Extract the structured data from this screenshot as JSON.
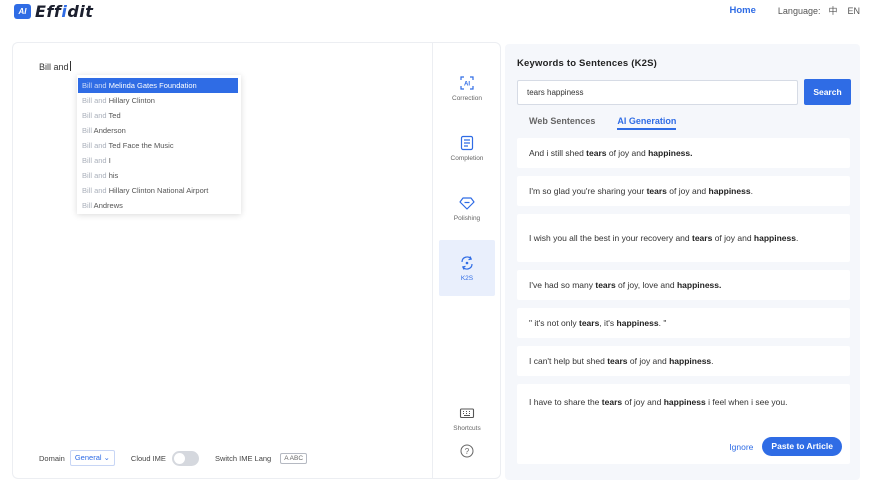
{
  "header": {
    "logo_badge": "AI",
    "logo_text_prefix": "Eff",
    "logo_text_highlight": "i",
    "logo_text_suffix": "dit",
    "nav_home": "Home",
    "language_label": "Language:",
    "lang_zh": "中",
    "lang_en": "EN"
  },
  "editor": {
    "text": "Bill and",
    "suggestions": [
      {
        "prefix": "Bill and",
        "completion": " Melinda Gates Foundation",
        "active": true
      },
      {
        "prefix": "Bill and",
        "completion": " Hillary Clinton"
      },
      {
        "prefix": "Bill and",
        "completion": " Ted"
      },
      {
        "prefix": "Bill",
        "completion": " Anderson"
      },
      {
        "prefix": "Bill and",
        "completion": " Ted Face the Music"
      },
      {
        "prefix": "Bill and",
        "completion": " I"
      },
      {
        "prefix": "Bill and",
        "completion": " his"
      },
      {
        "prefix": "Bill and",
        "completion": " Hillary Clinton National Airport"
      },
      {
        "prefix": "Bill",
        "completion": " Andrews"
      }
    ],
    "domain_label": "Domain",
    "domain_value": "General",
    "cloud_ime_label": "Cloud IME",
    "cloud_ime_on": false,
    "switch_ime_label": "Switch IME Lang",
    "ime_badge": "A ABC"
  },
  "tools": [
    {
      "label": "Correction",
      "icon": "correction-icon",
      "active": false
    },
    {
      "label": "Completion",
      "icon": "completion-icon",
      "active": false
    },
    {
      "label": "Polishing",
      "icon": "polishing-icon",
      "active": false
    },
    {
      "label": "K2S",
      "icon": "k2s-icon",
      "active": true
    }
  ],
  "shortcuts_label": "Shortcuts",
  "k2s": {
    "title": "Keywords to Sentences (K2S)",
    "query": "tears happiness",
    "search_label": "Search",
    "tabs": [
      {
        "label": "Web Sentences",
        "active": false
      },
      {
        "label": "AI Generation",
        "active": true
      }
    ],
    "results": [
      [
        [
          "And i still shed ",
          false
        ],
        [
          "tears",
          true
        ],
        [
          " of joy and ",
          false
        ],
        [
          "happiness.",
          true
        ]
      ],
      [
        [
          "I'm so glad you're sharing your ",
          false
        ],
        [
          "tears",
          true
        ],
        [
          " of joy and ",
          false
        ],
        [
          "happiness",
          true
        ],
        [
          ".",
          false
        ]
      ],
      [
        [
          "I wish you all the best in your recovery and ",
          false
        ],
        [
          "tears",
          true
        ],
        [
          " of joy and ",
          false
        ],
        [
          "happiness",
          true
        ],
        [
          ".",
          false
        ]
      ],
      [
        [
          "I've had so many ",
          false
        ],
        [
          "tears",
          true
        ],
        [
          " of joy, love and ",
          false
        ],
        [
          "happiness.",
          true
        ]
      ],
      [
        [
          "\" it's not only ",
          false
        ],
        [
          "tears",
          true
        ],
        [
          ", it's ",
          false
        ],
        [
          "happiness",
          true
        ],
        [
          ". \"",
          false
        ]
      ],
      [
        [
          "I can't help but shed ",
          false
        ],
        [
          "tears",
          true
        ],
        [
          " of joy and ",
          false
        ],
        [
          "happiness",
          true
        ],
        [
          ".",
          false
        ]
      ],
      [
        [
          "I have to share the ",
          false
        ],
        [
          "tears",
          true
        ],
        [
          " of joy and ",
          false
        ],
        [
          "happiness",
          true
        ],
        [
          " i feel when i see you.",
          false
        ]
      ]
    ],
    "ignore_label": "Ignore",
    "paste_label": "Paste to Article"
  }
}
